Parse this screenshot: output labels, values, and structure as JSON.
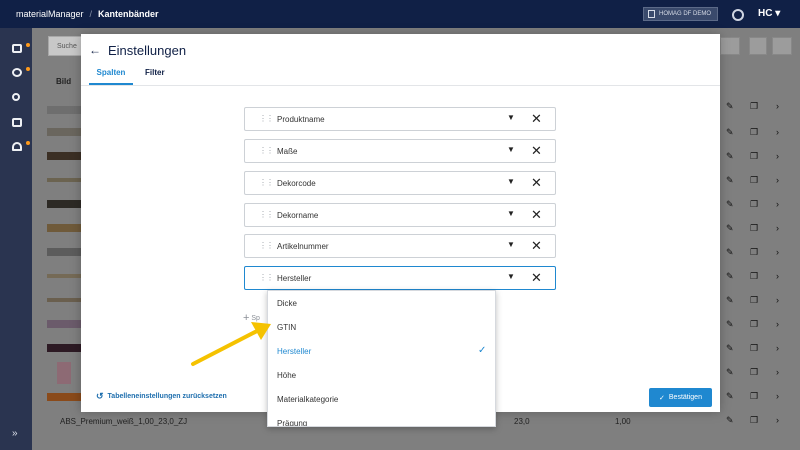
{
  "app": {
    "name": "materialManager",
    "separator": "/",
    "breadcrumb": "Kantenbänder",
    "tenant": "HOMAG DF DEMO",
    "logo": "HC"
  },
  "background": {
    "search_placeholder": "Suche",
    "column_bild": "Bild",
    "bottom_row": {
      "name": "ABS_Premium_weiß_1,00_23,0_ZJ",
      "width": "23,0",
      "thickness": "1,00"
    }
  },
  "modal": {
    "title": "Einstellungen",
    "tabs": [
      {
        "label": "Spalten",
        "active": true
      },
      {
        "label": "Filter",
        "active": false
      }
    ],
    "columns": [
      {
        "label": "Produktname"
      },
      {
        "label": "Maße"
      },
      {
        "label": "Dekorcode"
      },
      {
        "label": "Dekorname"
      },
      {
        "label": "Artikelnummer"
      },
      {
        "label": "Hersteller"
      }
    ],
    "add_hint": "Sp",
    "reset_label": "Tabelleneinstellungen zurücksetzen",
    "confirm_label": "Bestätigen"
  },
  "dropdown": {
    "options": [
      {
        "label": "Dicke",
        "selected": false
      },
      {
        "label": "GTIN",
        "selected": false
      },
      {
        "label": "Hersteller",
        "selected": true
      },
      {
        "label": "Höhe",
        "selected": false
      },
      {
        "label": "Materialkategorie",
        "selected": false
      },
      {
        "label": "Prägung",
        "selected": false
      }
    ]
  },
  "icons": {
    "back": "back-arrow-icon",
    "drag": "drag-handle-icon",
    "caret": "caret-down-icon",
    "remove": "close-icon",
    "check": "check-icon",
    "reset": "reset-icon",
    "confirm": "check-icon"
  },
  "colors": {
    "topbar": "#102046",
    "accent": "#1f88d0",
    "notification": "#ff9a1a",
    "annotation_arrow": "#f5c200"
  }
}
